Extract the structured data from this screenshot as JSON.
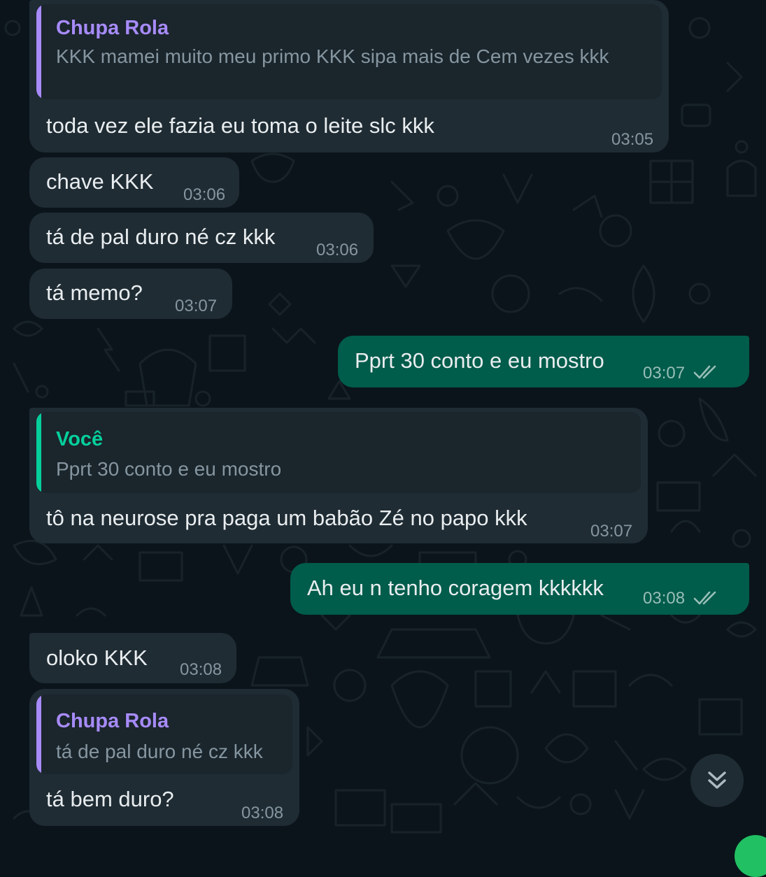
{
  "messages": [
    {
      "id": "m1",
      "dir": "in",
      "reply": {
        "name": "Chupa Rola",
        "text": "KKK mamei muito meu primo KKK sipa mais de Cem vezes kkk"
      },
      "text": "toda vez ele fazia eu toma o leite slc kkk",
      "time": "03:05"
    },
    {
      "id": "m2",
      "dir": "in",
      "text": "chave KKK",
      "time": "03:06"
    },
    {
      "id": "m3",
      "dir": "in",
      "text": "tá de pal duro né cz kkk",
      "time": "03:06"
    },
    {
      "id": "m4",
      "dir": "in",
      "text": "tá memo?",
      "time": "03:07"
    },
    {
      "id": "m5",
      "dir": "out",
      "text": "Pprt 30 conto e eu mostro",
      "time": "03:07",
      "status": "read"
    },
    {
      "id": "m6",
      "dir": "in",
      "reply": {
        "name": "Você",
        "text": "Pprt 30 conto e eu mostro"
      },
      "text": "tô na neurose pra paga um babão Zé no papo kkk",
      "time": "03:07"
    },
    {
      "id": "m7",
      "dir": "out",
      "text": "Ah eu n tenho coragem kkkkkk",
      "time": "03:08",
      "status": "read"
    },
    {
      "id": "m8",
      "dir": "in",
      "text": "oloko KKK",
      "time": "03:08"
    },
    {
      "id": "m9",
      "dir": "in",
      "reply": {
        "name": "Chupa Rola",
        "text": "tá de pal duro né cz kkk"
      },
      "text": "tá bem duro?",
      "time": "03:08"
    }
  ],
  "colors": {
    "background": "#0b141a",
    "incoming_bubble": "#1f2c34",
    "outgoing_bubble": "#005c4b",
    "quote_purple": "#a78bfa",
    "quote_green": "#06cf9c",
    "timestamp": "#8696a0"
  },
  "icons": {
    "read_receipt": "double-check-icon",
    "scroll_down": "chevrons-down-icon"
  }
}
